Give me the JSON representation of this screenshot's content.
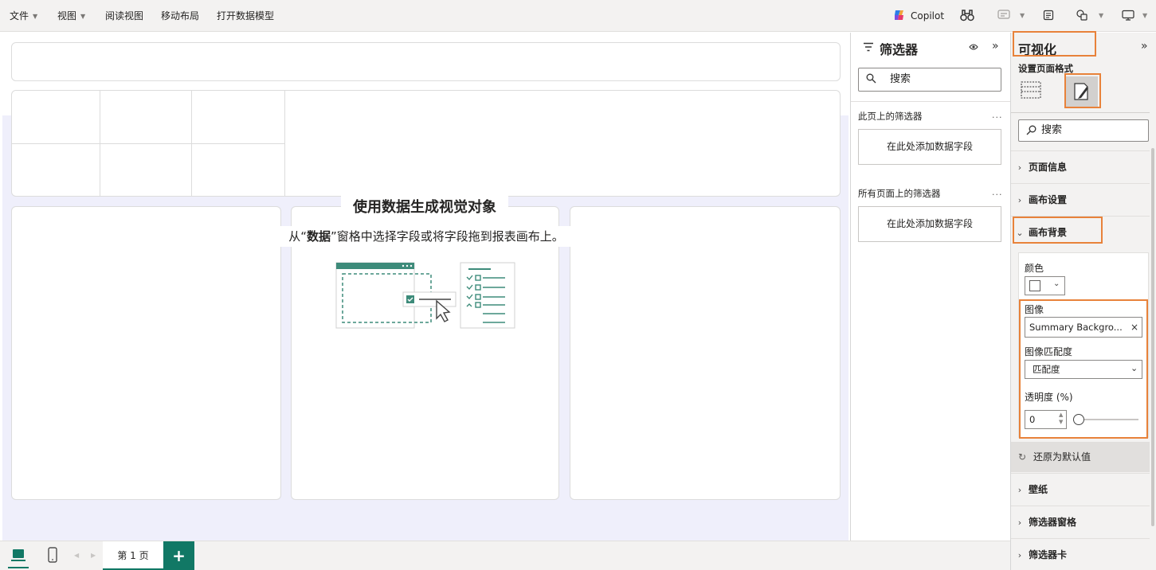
{
  "menu": {
    "file": "文件",
    "view": "视图",
    "reading_view": "阅读视图",
    "mobile_layout": "移动布局",
    "open_data_model": "打开数据模型",
    "copilot": "Copilot"
  },
  "canvas": {
    "empty_title": "使用数据生成视觉对象",
    "empty_sub_pre": "从“",
    "empty_sub_bold": "数据",
    "empty_sub_post": "”窗格中选择字段或将字段拖到报表画布上。"
  },
  "filters": {
    "title": "筛选器",
    "search_placeholder": "搜索",
    "this_page": "此页上的筛选器",
    "all_pages": "所有页面上的筛选器",
    "add_field": "在此处添加数据字段",
    "more": "..."
  },
  "viz": {
    "title": "可视化",
    "format_page": "设置页面格式",
    "search_placeholder": "搜索",
    "sections": {
      "page_info": "页面信息",
      "canvas_settings": "画布设置",
      "canvas_background": "画布背景",
      "wallpaper": "壁纸",
      "filter_pane": "筛选器窗格",
      "filter_card": "筛选器卡"
    },
    "color_label": "颜色",
    "image_label": "图像",
    "image_value": "Summary Backgro...",
    "image_fit_label": "图像匹配度",
    "image_fit_value": "匹配度",
    "transparency_label": "透明度 (%)",
    "transparency_value": "0",
    "transparency_percent": 0,
    "reset": "还原为默认值"
  },
  "pages": {
    "page1": "第 1 页",
    "add": "+"
  },
  "colors": {
    "accent": "#117865",
    "highlight": "#e8823a"
  }
}
